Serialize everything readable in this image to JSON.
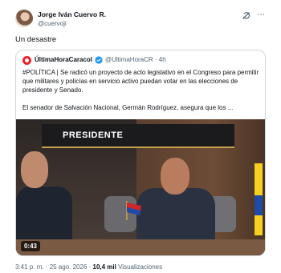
{
  "author": {
    "name": "Jorge Iván Cuervo R.",
    "handle": "@cuervoji"
  },
  "tweet": {
    "text": "Un desastre"
  },
  "quoted": {
    "name": "ÚltimaHoraCaracol",
    "handle_time": "@UltimaHoraCR · 4h",
    "paragraph1": "#POLÍTICA | Se radicó un proyecto de acto legislativo en el Congreso para permitir que militares y policías en servicio activo puedan votar en las elecciones de presidente y Senado.",
    "paragraph2": "El senador de Salvación Nacional, Germán Rodríguez, asegura que los ...",
    "video": {
      "sign_text": "PRESIDENTE",
      "duration": "0:43"
    }
  },
  "meta": {
    "time": "3:41 p. m.",
    "separator": " · ",
    "date": "25 ago. 2026",
    "views_count": "10,4 mil",
    "views_label": " Visualizaciones"
  },
  "icons": {
    "grok": "grok-icon",
    "more": "more-icon",
    "verified": "verified-badge-icon",
    "source_logo": "caracol-logo-icon"
  },
  "colors": {
    "text": "#0f1419",
    "secondary": "#536471",
    "verified": "#1d9bf0",
    "brand_red": "#e8232d"
  }
}
